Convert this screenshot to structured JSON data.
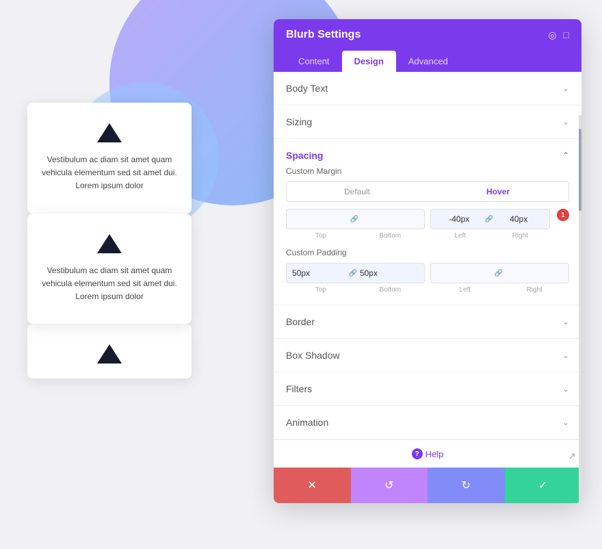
{
  "background": {
    "circle_large": "gradient",
    "circle_small": "light blue"
  },
  "cards": [
    {
      "text": "Vestibulum ac diam sit amet quam vehicula elementum sed sit amet dui. Lorem ipsum dolor"
    },
    {
      "text": "Vestibulum ac diam sit amet quam vehicula elementum sed sit amet dui. Lorem ipsum dolor"
    },
    {
      "text": ""
    }
  ],
  "panel": {
    "title": "Blurb Settings",
    "tabs": [
      {
        "label": "Content",
        "active": false
      },
      {
        "label": "Design",
        "active": true
      },
      {
        "label": "Advanced",
        "active": false
      }
    ],
    "sections": [
      {
        "label": "Body Text",
        "expanded": false
      },
      {
        "label": "Sizing",
        "expanded": false
      },
      {
        "label": "Spacing",
        "expanded": true,
        "accent": true
      },
      {
        "label": "Border",
        "expanded": false
      },
      {
        "label": "Box Shadow",
        "expanded": false
      },
      {
        "label": "Filters",
        "expanded": false
      },
      {
        "label": "Animation",
        "expanded": false
      }
    ],
    "spacing": {
      "custom_margin_label": "Custom Margin",
      "default_tab": "Default",
      "hover_tab": "Hover",
      "margin_top_placeholder": "",
      "margin_bottom_placeholder": "",
      "margin_left_value": "-40px",
      "margin_right_value": "40px",
      "margin_top_label": "Top",
      "margin_bottom_label": "Bottom",
      "margin_left_label": "Left",
      "margin_right_label": "Right",
      "badge_count": "1",
      "custom_padding_label": "Custom Padding",
      "padding_top_value": "50px",
      "padding_bottom_value": "50px",
      "padding_left_value": "",
      "padding_right_value": "",
      "padding_top_label": "Top",
      "padding_bottom_label": "Bottom",
      "padding_left_label": "Left",
      "padding_right_label": "Right"
    },
    "help_label": "Help",
    "footer_buttons": {
      "cancel": "✕",
      "undo": "↺",
      "redo": "↻",
      "save": "✓"
    }
  }
}
